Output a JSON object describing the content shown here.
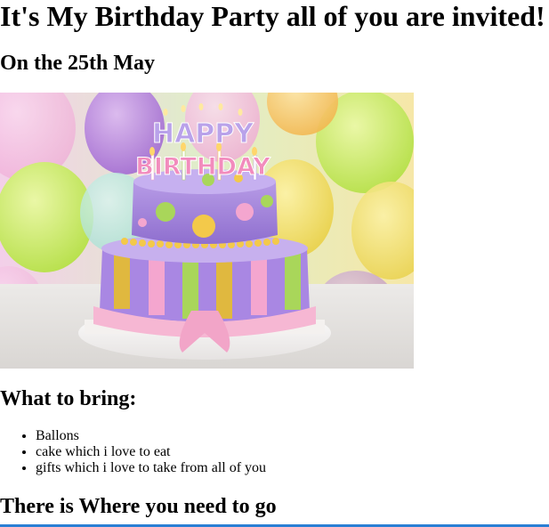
{
  "page": {
    "title": "It's My Birthday Party all of you are invited!",
    "date_heading": "On the 25th May"
  },
  "image": {
    "description": "birthday-cake-photo",
    "cake_text_top": "HAPPY",
    "cake_text_bottom": "BIRTHDAY"
  },
  "bring": {
    "heading": "What to bring:",
    "items": [
      "Ballons",
      "cake which i love to eat",
      "gifts which i love to take from all of you"
    ]
  },
  "location": {
    "heading": "There is Where you need to go"
  },
  "colors": {
    "map_frame_border": "#2a7fd4"
  }
}
